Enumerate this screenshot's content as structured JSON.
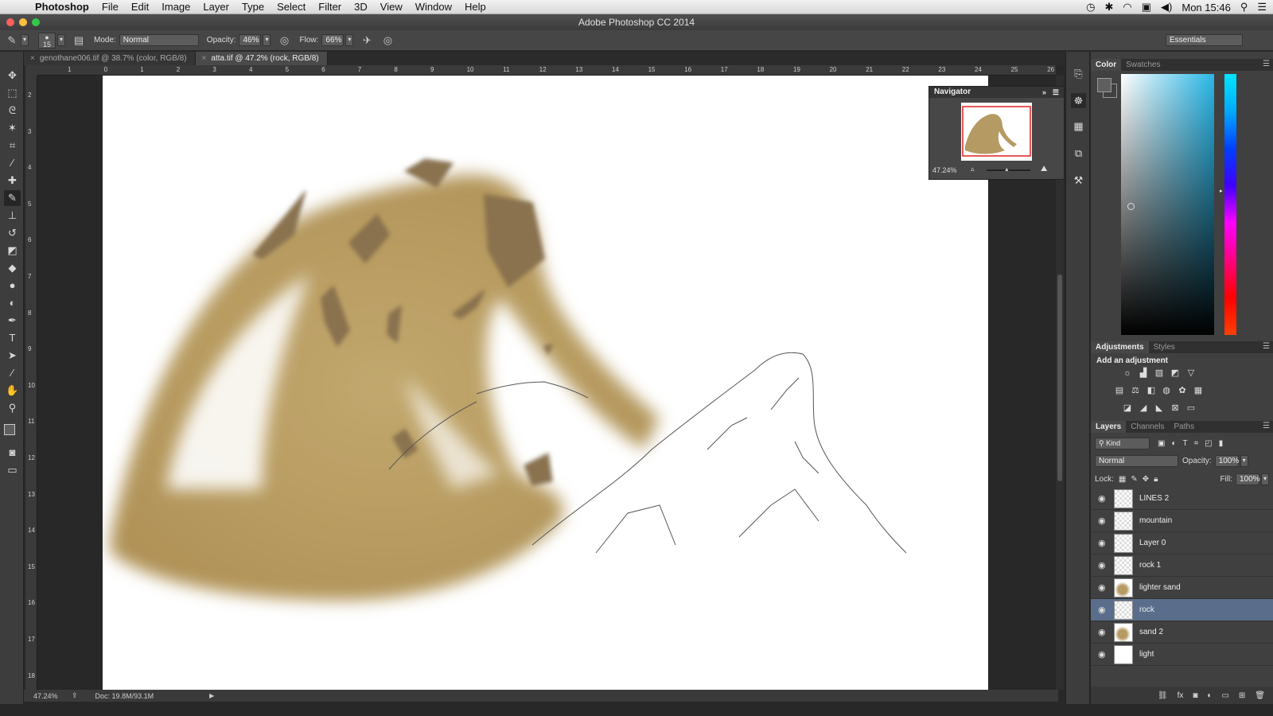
{
  "menubar": {
    "app": "Photoshop",
    "items": [
      "File",
      "Edit",
      "Image",
      "Layer",
      "Type",
      "Select",
      "Filter",
      "3D",
      "View",
      "Window",
      "Help"
    ],
    "clock": "Mon 15:46"
  },
  "window": {
    "title": "Adobe Photoshop CC 2014"
  },
  "options": {
    "brush_size": "15",
    "mode_label": "Mode:",
    "mode_value": "Normal",
    "opacity_label": "Opacity:",
    "opacity_value": "46%",
    "flow_label": "Flow:",
    "flow_value": "66%",
    "workspace": "Essentials"
  },
  "tabs": [
    {
      "label": "genothane006.tif @ 38.7% (color, RGB/8)",
      "active": false
    },
    {
      "label": "atta.tif @ 47.2% (rock, RGB/8)",
      "active": true
    }
  ],
  "rulers": {
    "h": [
      "1",
      "0",
      "1",
      "2",
      "3",
      "4",
      "5",
      "6",
      "7",
      "8",
      "9",
      "10",
      "11",
      "12",
      "13",
      "14",
      "15",
      "16",
      "17",
      "18",
      "19",
      "20",
      "21",
      "22",
      "23",
      "24",
      "25",
      "26"
    ],
    "v": [
      "2",
      "3",
      "4",
      "5",
      "6",
      "7",
      "8",
      "9",
      "10",
      "11",
      "12",
      "13",
      "14",
      "15",
      "16",
      "17",
      "18"
    ]
  },
  "status": {
    "zoom": "47.24%",
    "doc": "Doc: 19.8M/93.1M"
  },
  "navigator": {
    "title": "Navigator",
    "zoom": "47.24%",
    "zoom_fraction": 0.47
  },
  "color_panel": {
    "tabs": [
      "Color",
      "Swatches"
    ],
    "hue_color": "#2ab7e8"
  },
  "adjustments": {
    "tabs": [
      "Adjustments",
      "Styles"
    ],
    "heading": "Add an adjustment"
  },
  "layers_panel": {
    "tabs": [
      "Layers",
      "Channels",
      "Paths"
    ],
    "filter_label": "Kind",
    "blend_mode": "Normal",
    "opacity_label": "Opacity:",
    "opacity_value": "100%",
    "lock_label": "Lock:",
    "fill_label": "Fill:",
    "fill_value": "100%",
    "layers": [
      {
        "name": "LINES 2",
        "selected": false
      },
      {
        "name": "mountain",
        "selected": false
      },
      {
        "name": "Layer 0",
        "selected": false
      },
      {
        "name": "rock 1",
        "selected": false
      },
      {
        "name": "lighter sand",
        "selected": false
      },
      {
        "name": "rock",
        "selected": true
      },
      {
        "name": "sand 2",
        "selected": false
      },
      {
        "name": "light",
        "selected": false
      }
    ]
  },
  "colors": {
    "selected_layer": "#5a6e8c",
    "panel_bg": "#404040",
    "sand": "#c8b07a"
  }
}
